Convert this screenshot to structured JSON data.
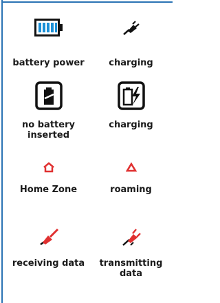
{
  "items": [
    {
      "icon": "battery-full-icon",
      "label": "battery power"
    },
    {
      "icon": "charging-plug-icon",
      "label": "charging"
    },
    {
      "icon": "no-battery-icon",
      "label": "no battery\ninserted"
    },
    {
      "icon": "battery-charging-icon",
      "label": "charging"
    },
    {
      "icon": "home-zone-icon",
      "label": "Home Zone"
    },
    {
      "icon": "roaming-icon",
      "label": "roaming"
    },
    {
      "icon": "receiving-data-icon",
      "label": "receiving data"
    },
    {
      "icon": "transmitting-data-icon",
      "label": "transmitting\ndata"
    }
  ],
  "colors": {
    "frame": "#2a73b4",
    "battery": "#1a8fd6",
    "red": "#e03030",
    "dark": "#1a1a1a"
  }
}
